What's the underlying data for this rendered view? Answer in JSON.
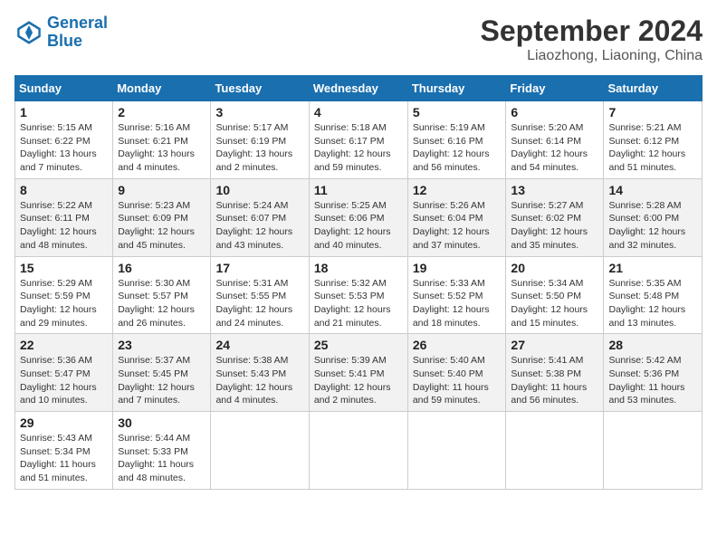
{
  "header": {
    "logo_line1": "General",
    "logo_line2": "Blue",
    "title": "September 2024",
    "subtitle": "Liaozhong, Liaoning, China"
  },
  "columns": [
    "Sunday",
    "Monday",
    "Tuesday",
    "Wednesday",
    "Thursday",
    "Friday",
    "Saturday"
  ],
  "weeks": [
    [
      {
        "day": "1",
        "info": "Sunrise: 5:15 AM\nSunset: 6:22 PM\nDaylight: 13 hours and 7 minutes."
      },
      {
        "day": "2",
        "info": "Sunrise: 5:16 AM\nSunset: 6:21 PM\nDaylight: 13 hours and 4 minutes."
      },
      {
        "day": "3",
        "info": "Sunrise: 5:17 AM\nSunset: 6:19 PM\nDaylight: 13 hours and 2 minutes."
      },
      {
        "day": "4",
        "info": "Sunrise: 5:18 AM\nSunset: 6:17 PM\nDaylight: 12 hours and 59 minutes."
      },
      {
        "day": "5",
        "info": "Sunrise: 5:19 AM\nSunset: 6:16 PM\nDaylight: 12 hours and 56 minutes."
      },
      {
        "day": "6",
        "info": "Sunrise: 5:20 AM\nSunset: 6:14 PM\nDaylight: 12 hours and 54 minutes."
      },
      {
        "day": "7",
        "info": "Sunrise: 5:21 AM\nSunset: 6:12 PM\nDaylight: 12 hours and 51 minutes."
      }
    ],
    [
      {
        "day": "8",
        "info": "Sunrise: 5:22 AM\nSunset: 6:11 PM\nDaylight: 12 hours and 48 minutes."
      },
      {
        "day": "9",
        "info": "Sunrise: 5:23 AM\nSunset: 6:09 PM\nDaylight: 12 hours and 45 minutes."
      },
      {
        "day": "10",
        "info": "Sunrise: 5:24 AM\nSunset: 6:07 PM\nDaylight: 12 hours and 43 minutes."
      },
      {
        "day": "11",
        "info": "Sunrise: 5:25 AM\nSunset: 6:06 PM\nDaylight: 12 hours and 40 minutes."
      },
      {
        "day": "12",
        "info": "Sunrise: 5:26 AM\nSunset: 6:04 PM\nDaylight: 12 hours and 37 minutes."
      },
      {
        "day": "13",
        "info": "Sunrise: 5:27 AM\nSunset: 6:02 PM\nDaylight: 12 hours and 35 minutes."
      },
      {
        "day": "14",
        "info": "Sunrise: 5:28 AM\nSunset: 6:00 PM\nDaylight: 12 hours and 32 minutes."
      }
    ],
    [
      {
        "day": "15",
        "info": "Sunrise: 5:29 AM\nSunset: 5:59 PM\nDaylight: 12 hours and 29 minutes."
      },
      {
        "day": "16",
        "info": "Sunrise: 5:30 AM\nSunset: 5:57 PM\nDaylight: 12 hours and 26 minutes."
      },
      {
        "day": "17",
        "info": "Sunrise: 5:31 AM\nSunset: 5:55 PM\nDaylight: 12 hours and 24 minutes."
      },
      {
        "day": "18",
        "info": "Sunrise: 5:32 AM\nSunset: 5:53 PM\nDaylight: 12 hours and 21 minutes."
      },
      {
        "day": "19",
        "info": "Sunrise: 5:33 AM\nSunset: 5:52 PM\nDaylight: 12 hours and 18 minutes."
      },
      {
        "day": "20",
        "info": "Sunrise: 5:34 AM\nSunset: 5:50 PM\nDaylight: 12 hours and 15 minutes."
      },
      {
        "day": "21",
        "info": "Sunrise: 5:35 AM\nSunset: 5:48 PM\nDaylight: 12 hours and 13 minutes."
      }
    ],
    [
      {
        "day": "22",
        "info": "Sunrise: 5:36 AM\nSunset: 5:47 PM\nDaylight: 12 hours and 10 minutes."
      },
      {
        "day": "23",
        "info": "Sunrise: 5:37 AM\nSunset: 5:45 PM\nDaylight: 12 hours and 7 minutes."
      },
      {
        "day": "24",
        "info": "Sunrise: 5:38 AM\nSunset: 5:43 PM\nDaylight: 12 hours and 4 minutes."
      },
      {
        "day": "25",
        "info": "Sunrise: 5:39 AM\nSunset: 5:41 PM\nDaylight: 12 hours and 2 minutes."
      },
      {
        "day": "26",
        "info": "Sunrise: 5:40 AM\nSunset: 5:40 PM\nDaylight: 11 hours and 59 minutes."
      },
      {
        "day": "27",
        "info": "Sunrise: 5:41 AM\nSunset: 5:38 PM\nDaylight: 11 hours and 56 minutes."
      },
      {
        "day": "28",
        "info": "Sunrise: 5:42 AM\nSunset: 5:36 PM\nDaylight: 11 hours and 53 minutes."
      }
    ],
    [
      {
        "day": "29",
        "info": "Sunrise: 5:43 AM\nSunset: 5:34 PM\nDaylight: 11 hours and 51 minutes."
      },
      {
        "day": "30",
        "info": "Sunrise: 5:44 AM\nSunset: 5:33 PM\nDaylight: 11 hours and 48 minutes."
      },
      {
        "day": "",
        "info": ""
      },
      {
        "day": "",
        "info": ""
      },
      {
        "day": "",
        "info": ""
      },
      {
        "day": "",
        "info": ""
      },
      {
        "day": "",
        "info": ""
      }
    ]
  ]
}
